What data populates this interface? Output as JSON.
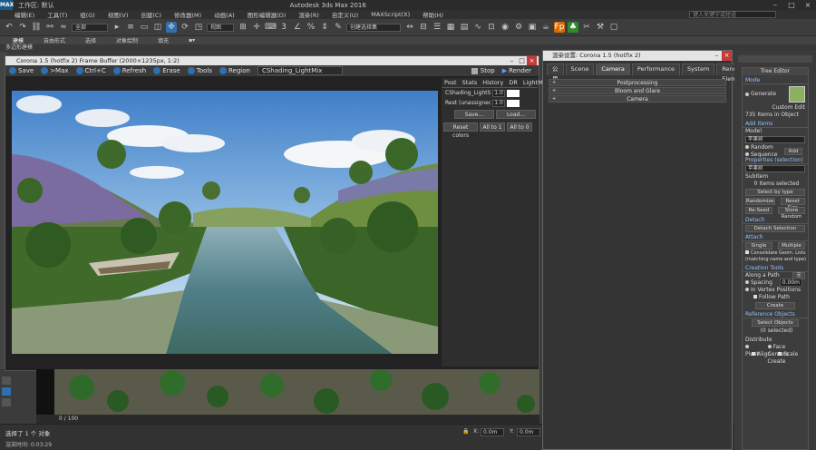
{
  "app": {
    "title_items": [
      "工作区: 默认"
    ],
    "window_title": "Autodesk 3ds Max 2016",
    "search_placeholder": "键入关键字或短语"
  },
  "menu": [
    "编辑(E)",
    "工具(T)",
    "组(G)",
    "视图(V)",
    "创建(C)",
    "修改器(M)",
    "动画(A)",
    "图形编辑器(D)",
    "渲染(R)",
    "自定义(U)",
    "MAXScript(X)",
    "帮助(H)"
  ],
  "toolbar": {
    "filter": "全部",
    "view": "视图",
    "named_selection": "创建选择集"
  },
  "ribbon": {
    "tabs": [
      "建模",
      "自由形式",
      "选择",
      "对象绘制",
      "填充"
    ],
    "active": "建模",
    "sub": "多边形建模"
  },
  "vfb": {
    "title": "Corona 1.5 (hotfix 2) Frame Buffer (2000×1235px, 1:2)",
    "buttons": [
      "Save",
      ">Max",
      "Ctrl+C",
      "Refresh",
      "Erase",
      "Tools",
      "Region"
    ],
    "channel": "CShading_LightMix",
    "stop": "Stop",
    "render": "Render",
    "tabs": [
      "Post",
      "Stats",
      "History",
      "DR",
      "LightMix"
    ],
    "rows": [
      {
        "label": "CShading_LightSelect",
        "value": "1.0"
      },
      {
        "label": "Rest (unassigned):",
        "value": "1.0"
      }
    ],
    "save": "Save...",
    "load": "Load...",
    "reset": "Reset colors",
    "all1": "All to 1",
    "all0": "All to 0"
  },
  "rsd": {
    "title": "渲染设置: Corona 1.5 (hotfix 2)",
    "tabs": [
      "公用",
      "Scene",
      "Camera",
      "Performance",
      "System",
      "Render Elements"
    ],
    "active_tab": "Camera",
    "rollouts": [
      "Postprocessing",
      "Bloom and Glare",
      "Camera"
    ]
  },
  "tree": {
    "header": "Tree Editor",
    "mode": "Mode",
    "generate": "Generate",
    "custom_edit": "Custom Edit",
    "items_count": "735 Items in Object",
    "add_items": "Add Items",
    "model": "Model",
    "model_value": "苹果树",
    "random": "Random",
    "sequence": "Sequence",
    "add": "Add",
    "properties": "Properties (selection)",
    "prop_value": "苹果树",
    "subitem": "SubItem",
    "selected": "0 Items selected",
    "select_type": "Select by type",
    "randomize": "Randomize",
    "reset_size": "Reset Size",
    "reseed": "Re-Seed",
    "store_random": "Store Random",
    "detach": "Detach",
    "detach_sel": "Detach Selection",
    "attach": "Attach",
    "single": "Single",
    "multiple": "Multiple",
    "consolidate": "Consolidate Geom. Lists (matching name and type)",
    "creation": "Creation Tools",
    "along_path": "Along a Path",
    "none": "无",
    "spacing": "Spacing",
    "spacing_val": "0.00m",
    "vertex": "In Vertex Positions",
    "follow": "Follow Path",
    "create": "Create",
    "ref_objects": "Reference Objects",
    "select_objects": "Select Objects",
    "none_selected": "(0 selected)",
    "distribute": "Distribute",
    "pivot": "Pivot",
    "face_centers": "Face Centers",
    "align": "Align",
    "scale": "Scale",
    "create2": "Create"
  },
  "timeline": {
    "frame": "0 / 100"
  },
  "status": {
    "selection": "选择了 1 个 对象",
    "render_time": "渲染时间: 0:03:29",
    "x": "0.0m",
    "y": "0.0m"
  },
  "colors": {
    "accent": "#2f6fb0",
    "close": "#c53a3a",
    "section": "#8fc1ff"
  }
}
